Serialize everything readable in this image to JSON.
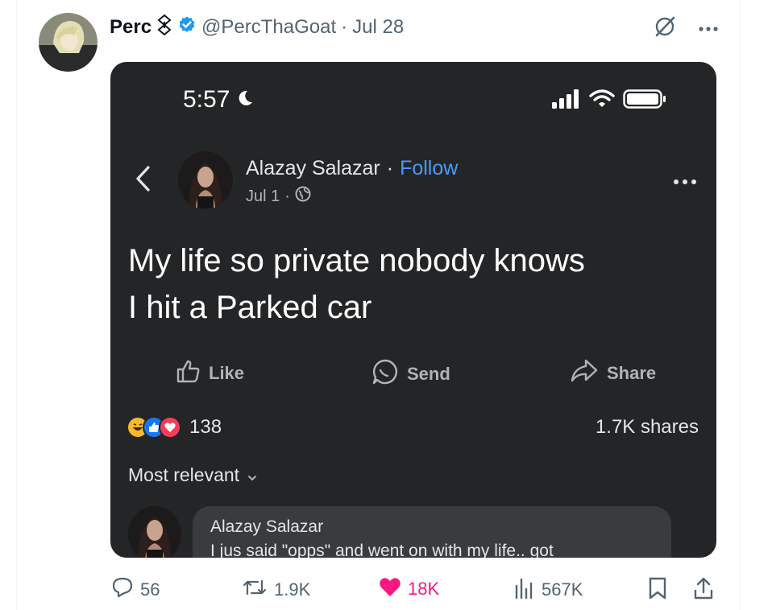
{
  "tweet": {
    "display_name": "Perc",
    "handle": "@PercThaGoat",
    "separator": "·",
    "date": "Jul 28"
  },
  "screenshot": {
    "status_time": "5:57",
    "post": {
      "author": "Alazay Salazar",
      "separator": "·",
      "follow_label": "Follow",
      "date": "Jul 1",
      "meta_separator": "·",
      "text_line1": "My life so private nobody knows",
      "text_line2": "I hit a Parked car"
    },
    "actions": {
      "like": "Like",
      "send": "Send",
      "share": "Share"
    },
    "reaction_count": "138",
    "shares_text": "1.7K shares",
    "sort_label": "Most relevant",
    "comment": {
      "author": "Alazay Salazar",
      "text": "I jus said \"opps\" and went on with my life.. got"
    }
  },
  "engagement": {
    "replies": "56",
    "reposts": "1.9K",
    "likes": "18K",
    "views": "567K"
  },
  "colors": {
    "verified_blue": "#1d9bf0",
    "like_pink": "#f91880",
    "card_bg": "#242526",
    "follow_blue": "#4a9bff"
  }
}
